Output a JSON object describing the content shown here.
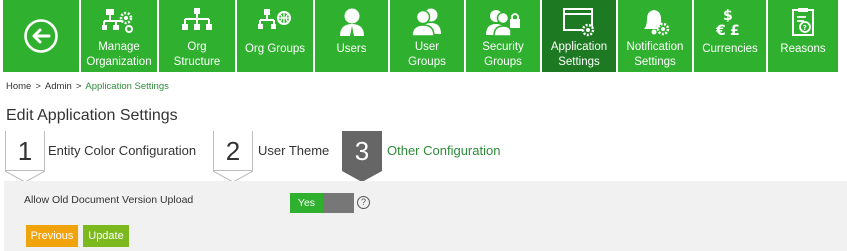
{
  "toolbar": {
    "back_icon": "back-arrow-circle-icon",
    "items": [
      {
        "label": "Manage\nOrganization",
        "icon": "org-settings-icon"
      },
      {
        "label": "Org\nStructure",
        "icon": "hierarchy-icon"
      },
      {
        "label": "Org Groups",
        "icon": "org-groups-icon"
      },
      {
        "label": "Users",
        "icon": "user-icon"
      },
      {
        "label": "User\nGroups",
        "icon": "user-groups-icon"
      },
      {
        "label": "Security\nGroups",
        "icon": "security-groups-icon"
      },
      {
        "label": "Application\nSettings",
        "icon": "application-settings-icon",
        "active": true
      },
      {
        "label": "Notification\nSettings",
        "icon": "notification-bell-icon"
      },
      {
        "label": "Currencies",
        "icon": "currency-icon"
      },
      {
        "label": "Reasons",
        "icon": "clipboard-question-icon"
      }
    ]
  },
  "breadcrumb": {
    "home": "Home",
    "admin": "Admin",
    "current": "Application Settings",
    "separator": ">"
  },
  "page_title": "Edit Application Settings",
  "steps": [
    {
      "number": "1",
      "label": "Entity Color Configuration"
    },
    {
      "number": "2",
      "label": "User Theme"
    },
    {
      "number": "3",
      "label": "Other Configuration",
      "current": true
    }
  ],
  "form": {
    "option_label": "Allow Old Document Version Upload",
    "toggle_value": "Yes",
    "help_symbol": "?",
    "previous_label": "Previous",
    "update_label": "Update"
  },
  "colors": {
    "tile": "#2fb12f",
    "tile_active": "#1e7a22",
    "accent_text": "#2e8b3a",
    "previous": "#f0a30a",
    "update": "#7cb91d"
  }
}
